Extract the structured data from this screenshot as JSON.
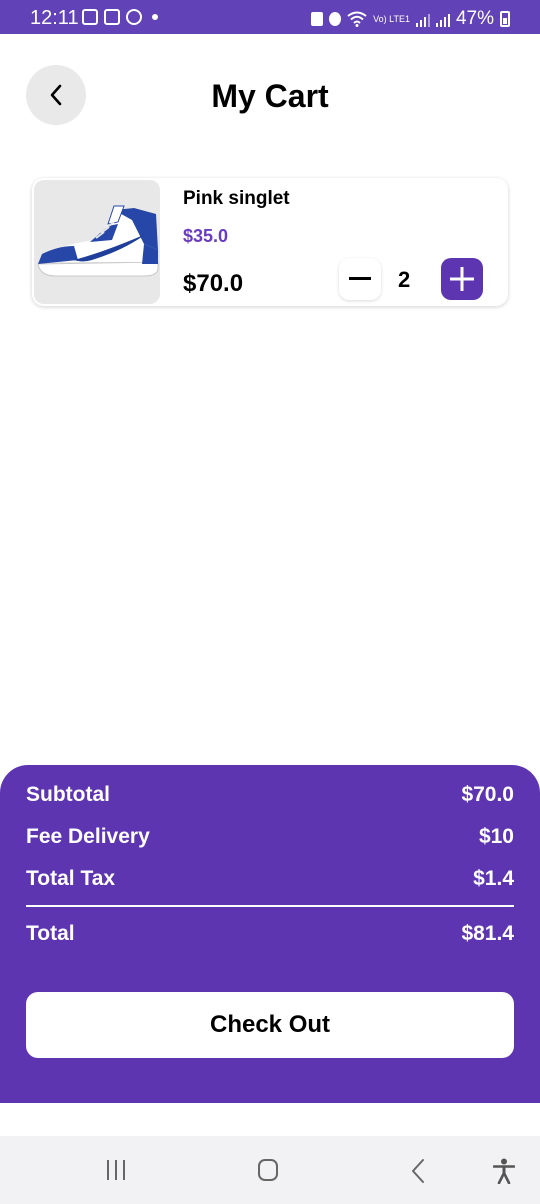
{
  "status_bar": {
    "time": "12:11",
    "battery": "47%",
    "network": "Vo) LTE1",
    "background": "#6142b7"
  },
  "header": {
    "title": "My Cart",
    "back_icon": "chevron-left-icon"
  },
  "cart": {
    "items": [
      {
        "name": "Pink singlet",
        "unit_price": "$35.0",
        "line_total": "$70.0",
        "quantity": "2",
        "image": "sneaker-image"
      }
    ]
  },
  "summary": {
    "subtotal_label": "Subtotal",
    "subtotal_value": "$70.0",
    "delivery_label": "Fee Delivery",
    "delivery_value": "$10",
    "tax_label": "Total Tax",
    "tax_value": "$1.4",
    "total_label": "Total",
    "total_value": "$81.4",
    "checkout_label": "Check Out",
    "accent_color": "#5e35b1"
  },
  "nav_bar": {
    "icons": [
      "recent-apps-icon",
      "home-icon",
      "back-icon",
      "accessibility-icon"
    ]
  }
}
